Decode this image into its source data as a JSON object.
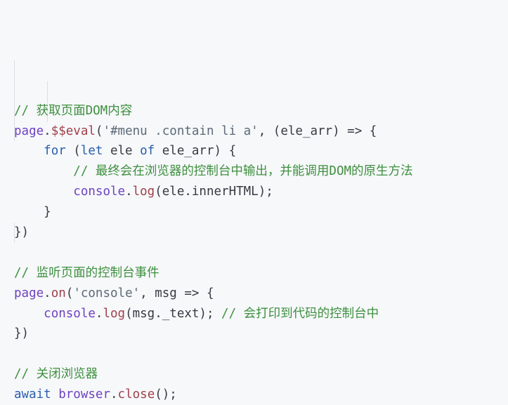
{
  "colors": {
    "background": "#f6f8fa",
    "comment": "#3f8f3f",
    "object": "#6f42c1",
    "function": "#a0404a",
    "string": "#5d6a78",
    "keyword": "#2a5db0",
    "plain": "#383a42"
  },
  "lines": [
    [
      {
        "t": "// 获取页面DOM内容",
        "k": "comment"
      }
    ],
    [
      {
        "t": "page",
        "k": "obj"
      },
      {
        "t": ".",
        "k": "plain"
      },
      {
        "t": "$$eval",
        "k": "fn"
      },
      {
        "t": "(",
        "k": "plain"
      },
      {
        "t": "'#menu .contain li a'",
        "k": "str"
      },
      {
        "t": ", (ele_arr) => {",
        "k": "plain"
      }
    ],
    [
      {
        "t": "    ",
        "k": "plain"
      },
      {
        "t": "for",
        "k": "kw"
      },
      {
        "t": " (",
        "k": "plain"
      },
      {
        "t": "let",
        "k": "kw"
      },
      {
        "t": " ele ",
        "k": "plain"
      },
      {
        "t": "of",
        "k": "kw"
      },
      {
        "t": " ele_arr) {",
        "k": "plain"
      }
    ],
    [
      {
        "t": "        ",
        "k": "plain"
      },
      {
        "t": "// 最终会在浏览器的控制台中输出，并能调用DOM的原生方法",
        "k": "comment"
      }
    ],
    [
      {
        "t": "        ",
        "k": "plain"
      },
      {
        "t": "console",
        "k": "obj"
      },
      {
        "t": ".",
        "k": "plain"
      },
      {
        "t": "log",
        "k": "fn"
      },
      {
        "t": "(ele.innerHTML);",
        "k": "plain"
      }
    ],
    [
      {
        "t": "    }",
        "k": "plain"
      }
    ],
    [
      {
        "t": "})",
        "k": "plain"
      }
    ],
    [
      {
        "t": "",
        "k": "plain"
      }
    ],
    [
      {
        "t": "// 监听页面的控制台事件",
        "k": "comment"
      }
    ],
    [
      {
        "t": "page",
        "k": "obj"
      },
      {
        "t": ".",
        "k": "plain"
      },
      {
        "t": "on",
        "k": "fn"
      },
      {
        "t": "(",
        "k": "plain"
      },
      {
        "t": "'console'",
        "k": "str"
      },
      {
        "t": ", msg => {",
        "k": "plain"
      }
    ],
    [
      {
        "t": "    ",
        "k": "plain"
      },
      {
        "t": "console",
        "k": "obj"
      },
      {
        "t": ".",
        "k": "plain"
      },
      {
        "t": "log",
        "k": "fn"
      },
      {
        "t": "(msg._text); ",
        "k": "plain"
      },
      {
        "t": "// 会打印到代码的控制台中",
        "k": "comment"
      }
    ],
    [
      {
        "t": "})",
        "k": "plain"
      }
    ],
    [
      {
        "t": "",
        "k": "plain"
      }
    ],
    [
      {
        "t": "// 关闭浏览器",
        "k": "comment"
      }
    ],
    [
      {
        "t": "await",
        "k": "kw"
      },
      {
        "t": " ",
        "k": "plain"
      },
      {
        "t": "browser",
        "k": "obj"
      },
      {
        "t": ".",
        "k": "plain"
      },
      {
        "t": "close",
        "k": "fn"
      },
      {
        "t": "();",
        "k": "plain"
      }
    ]
  ]
}
